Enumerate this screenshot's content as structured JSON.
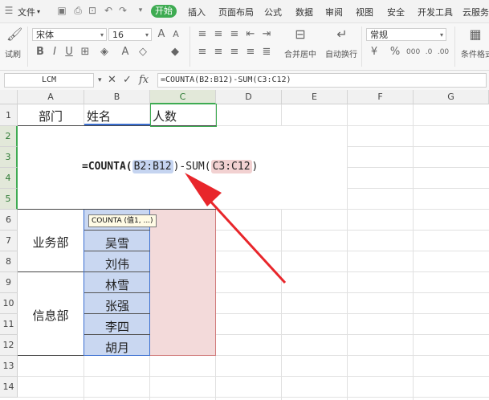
{
  "menubar": {
    "file_label": "文件",
    "start_tab": "开始",
    "tabs": [
      "插入",
      "页面布局",
      "公式",
      "数据",
      "审阅",
      "视图",
      "安全",
      "开发工具",
      "云服务"
    ]
  },
  "ribbon": {
    "font_name": "宋体",
    "font_size": "16",
    "number_format": "常规",
    "labels": {
      "format_painter": "试刷",
      "merge_center": "合并居中",
      "wrap_text": "自动换行",
      "conditional_format": "条件格式"
    }
  },
  "formula_bar": {
    "name_box": "LCM",
    "formula": "=COUNTA(B2:B12)-SUM(C3:C12)"
  },
  "sheet": {
    "columns": [
      "A",
      "B",
      "C",
      "D",
      "E",
      "F",
      "G"
    ],
    "active_column": "C",
    "rows": [
      "1",
      "2",
      "3",
      "4",
      "5",
      "6",
      "7",
      "8",
      "9",
      "10",
      "11",
      "12",
      "13",
      "14"
    ],
    "header_row": {
      "a1": "部门",
      "b1": "姓名",
      "c1": "人数"
    },
    "departments": [
      "业务部",
      "信息部"
    ],
    "names": [
      "吴雪",
      "刘伟",
      "林雪",
      "张强",
      "李四",
      "胡月"
    ],
    "editing_formula": {
      "prefix": "=COUNTA(",
      "ref1": "B2:B12",
      "middle": ")-SUM(",
      "ref2": "C3:C12",
      "suffix": ")"
    },
    "tooltip": "COUNTA (值1, ...)"
  },
  "colors": {
    "accent": "#3eab52",
    "range_b": "#c9d7f1",
    "range_c": "#f3dada",
    "arrow": "#e8262b"
  }
}
